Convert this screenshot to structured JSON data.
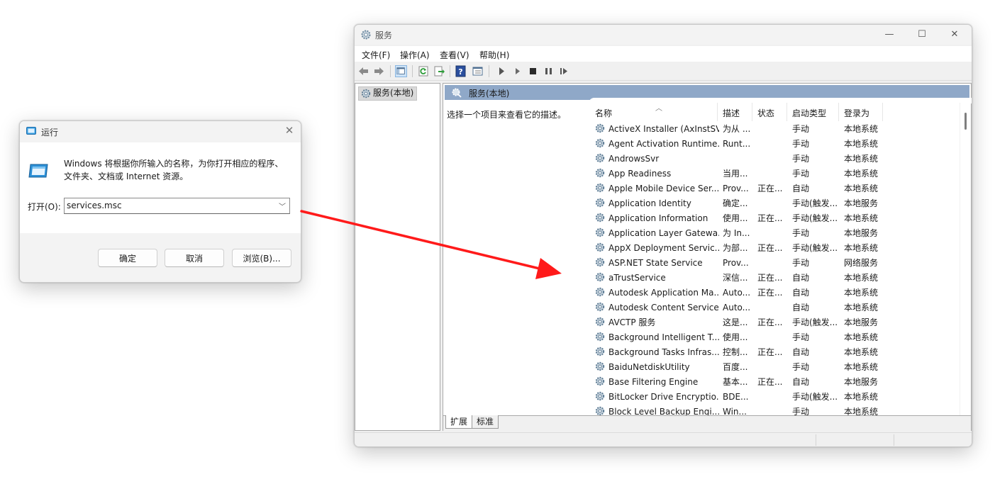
{
  "run_dialog": {
    "title": "运行",
    "description": "Windows 将根据你所输入的名称，为你打开相应的程序、文件夹、文档或 Internet 资源。",
    "open_label": "打开(O):",
    "open_value": "services.msc",
    "ok_label": "确定",
    "cancel_label": "取消",
    "browse_label": "浏览(B)..."
  },
  "services_window": {
    "title": "服务",
    "menus": [
      "文件(F)",
      "操作(A)",
      "查看(V)",
      "帮助(H)"
    ],
    "tree_node": "服务(本地)",
    "panel_title": "服务(本地)",
    "hint": "选择一个项目来查看它的描述。",
    "columns": [
      "名称",
      "描述",
      "状态",
      "启动类型",
      "登录为"
    ],
    "rows": [
      [
        "ActiveX Installer (AxInstSV)",
        "为从 ...",
        "",
        "手动",
        "本地系统"
      ],
      [
        "Agent Activation Runtime...",
        "Runt...",
        "",
        "手动",
        "本地系统"
      ],
      [
        "AndrowsSvr",
        "",
        "",
        "手动",
        "本地系统"
      ],
      [
        "App Readiness",
        "当用...",
        "",
        "手动",
        "本地系统"
      ],
      [
        "Apple Mobile Device Ser...",
        "Prov...",
        "正在...",
        "自动",
        "本地系统"
      ],
      [
        "Application Identity",
        "确定...",
        "",
        "手动(触发...",
        "本地服务"
      ],
      [
        "Application Information",
        "使用...",
        "正在...",
        "手动(触发...",
        "本地系统"
      ],
      [
        "Application Layer Gatewa...",
        "为 In...",
        "",
        "手动",
        "本地服务"
      ],
      [
        "AppX Deployment Servic...",
        "为部...",
        "正在...",
        "手动(触发...",
        "本地系统"
      ],
      [
        "ASP.NET State Service",
        "Prov...",
        "",
        "手动",
        "网络服务"
      ],
      [
        "aTrustService",
        "深信...",
        "正在...",
        "自动",
        "本地系统"
      ],
      [
        "Autodesk Application Ma...",
        "Auto...",
        "正在...",
        "自动",
        "本地系统"
      ],
      [
        "Autodesk Content Service",
        "Auto...",
        "",
        "自动",
        "本地系统"
      ],
      [
        "AVCTP 服务",
        "这是...",
        "正在...",
        "手动(触发...",
        "本地服务"
      ],
      [
        "Background Intelligent T...",
        "使用...",
        "",
        "手动",
        "本地系统"
      ],
      [
        "Background Tasks Infras...",
        "控制...",
        "正在...",
        "自动",
        "本地系统"
      ],
      [
        "BaiduNetdiskUtility",
        "百度...",
        "",
        "手动",
        "本地系统"
      ],
      [
        "Base Filtering Engine",
        "基本...",
        "正在...",
        "自动",
        "本地服务"
      ],
      [
        "BitLocker Drive Encryptio...",
        "BDE...",
        "",
        "手动(触发...",
        "本地系统"
      ],
      [
        "Block Level Backup Engi...",
        "Win...",
        "",
        "手动",
        "本地系统"
      ]
    ],
    "tabs": [
      "扩展",
      "标准"
    ],
    "accent_header_color": "#8fa8c8"
  },
  "annotation": {
    "arrow_color": "#ff1a1a"
  }
}
